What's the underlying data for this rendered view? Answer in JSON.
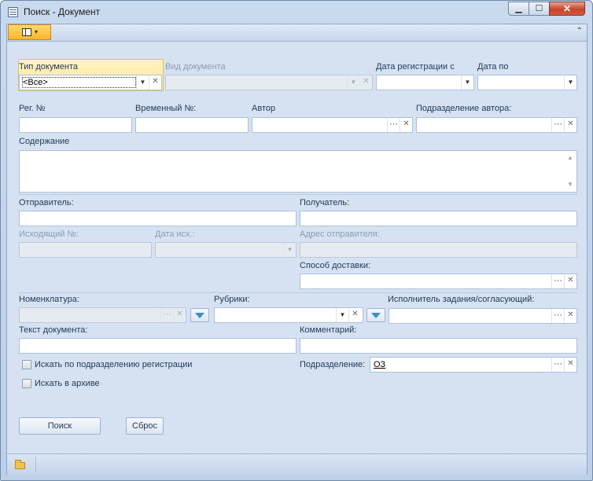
{
  "window": {
    "title": "Поиск - Документ",
    "min_label": "▁",
    "max_label": "☐",
    "close_label": "✕"
  },
  "ribbon": {
    "dropdown_arrow": "▾",
    "collapse_label": "⌃"
  },
  "fields": {
    "doc_type": {
      "label": "Тип документа",
      "value": "<Все>"
    },
    "doc_kind": {
      "label": "Вид документа"
    },
    "reg_date_from": {
      "label": "Дата регистрации с"
    },
    "reg_date_to": {
      "label": "Дата по"
    },
    "reg_no": {
      "label": "Рег. №"
    },
    "temp_no": {
      "label": "Временный №:"
    },
    "author": {
      "label": "Автор"
    },
    "author_dept": {
      "label": "Подразделение автора:"
    },
    "content": {
      "label": "Содержание"
    },
    "sender": {
      "label": "Отправитель:"
    },
    "recipient": {
      "label": "Получатель:"
    },
    "outgoing_no": {
      "label": "Исходящий №:"
    },
    "outgoing_date": {
      "label": "Дата исх.:"
    },
    "sender_address": {
      "label": "Адрес отправителя:"
    },
    "delivery_method": {
      "label": "Способ доставки:"
    },
    "nomenclature": {
      "label": "Номенклатура:"
    },
    "rubrics": {
      "label": "Рубрики:"
    },
    "executor": {
      "label": "Исполнитель задания/согласующий:"
    },
    "doc_text": {
      "label": "Текст документа:"
    },
    "comment": {
      "label": "Комментарий:"
    },
    "department": {
      "label": "Подразделение:",
      "value": "ОЗ"
    }
  },
  "checkboxes": {
    "search_by_reg_dept": {
      "label": "Искать по подразделению регистрации",
      "checked": false
    },
    "search_in_archive": {
      "label": "Искать в архиве",
      "checked": false
    }
  },
  "buttons": {
    "search": "Поиск",
    "reset": "Сброс"
  },
  "glyphs": {
    "dropdown": "▼",
    "ellipsis": "···",
    "clear": "✕",
    "scroll_up": "▲",
    "scroll_down": "▼"
  },
  "colors": {
    "accent_orange": "#f9b52a",
    "window_bg": "#d6e2f1",
    "label": "#1e395b"
  }
}
